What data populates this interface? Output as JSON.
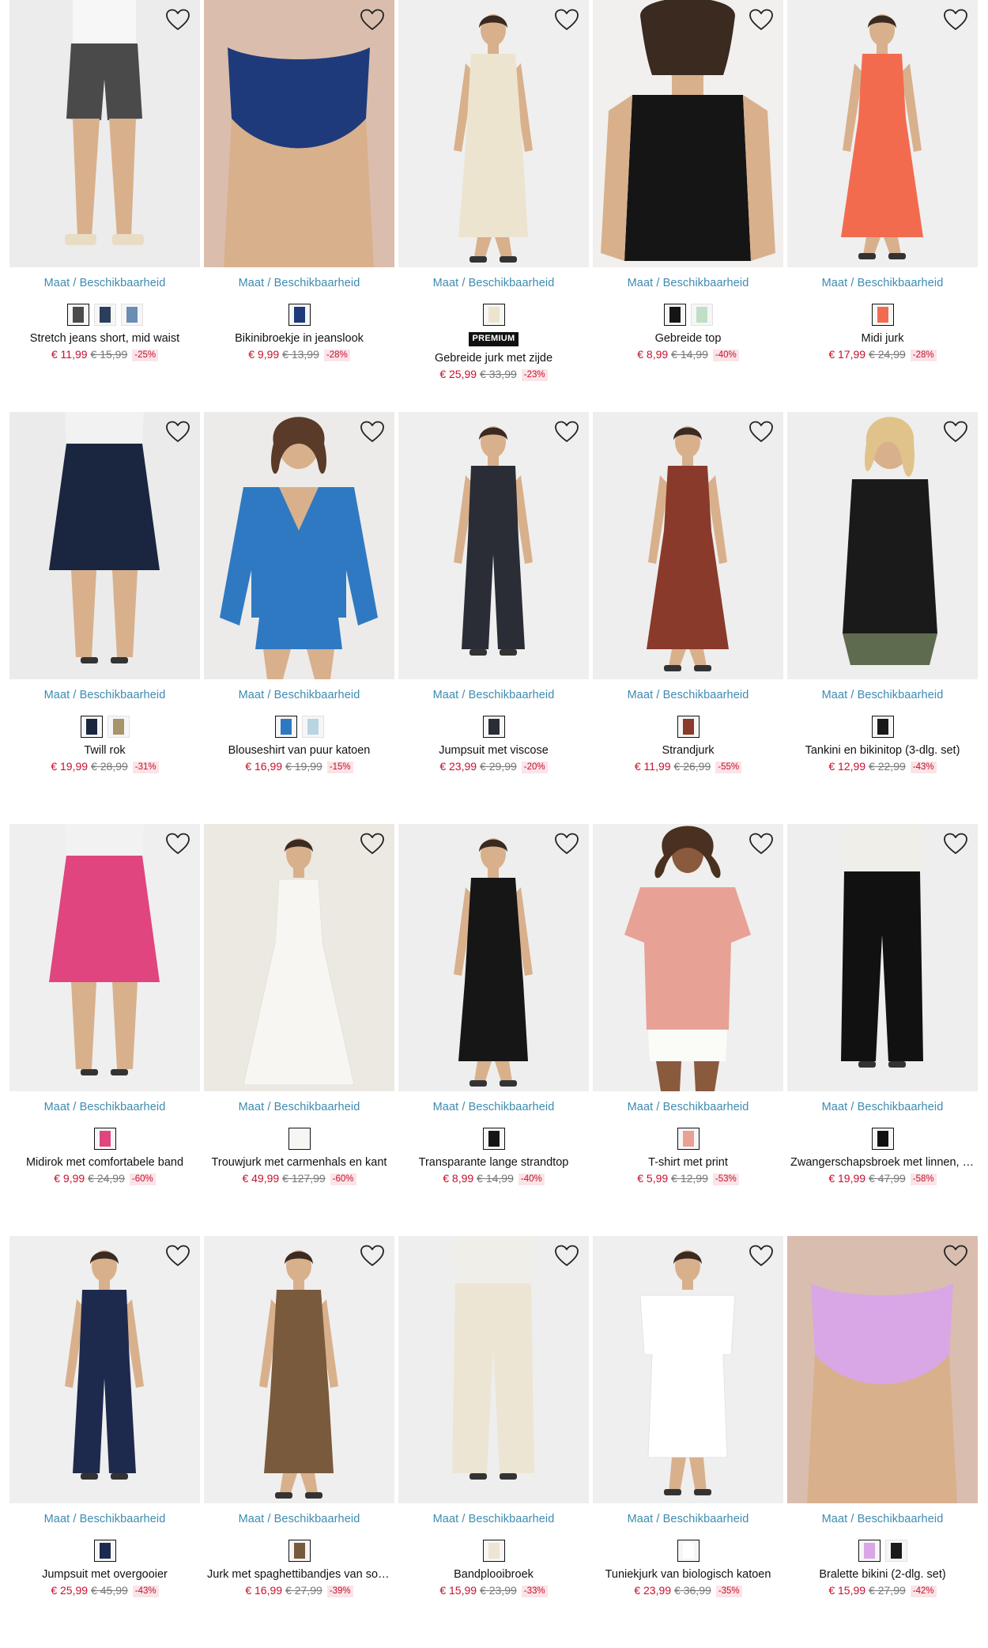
{
  "availability_label": "Maat / Beschikbaarheid",
  "premium_label": "PREMIUM",
  "products": [
    {
      "name": "Stretch jeans short, mid waist",
      "price": "€ 11,99",
      "old_price": "€ 15,99",
      "discount": "-25%",
      "bg": "#ececec",
      "figure": "shorts",
      "colors": [
        "#4a4a4a",
        "#2b3e5c",
        "#6b8cb3"
      ]
    },
    {
      "name": "Bikinibroekje in jeanslook",
      "price": "€ 9,99",
      "old_price": "€ 13,99",
      "discount": "-28%",
      "bg": "#f0eee9",
      "figure": "bikini",
      "colors": [
        "#1f3a7a"
      ]
    },
    {
      "name": "Gebreide jurk met zijde",
      "price": "€ 25,99",
      "old_price": "€ 33,99",
      "discount": "-23%",
      "bg": "#efefef",
      "figure": "dress",
      "premium": true,
      "colors": [
        "#ece4cf"
      ]
    },
    {
      "name": "Gebreide top",
      "price": "€ 8,99",
      "old_price": "€ 14,99",
      "discount": "-40%",
      "bg": "#f1f0ee",
      "figure": "top",
      "colors": [
        "#151515",
        "#bfe0c6"
      ]
    },
    {
      "name": "Midi jurk",
      "price": "€ 17,99",
      "old_price": "€ 24,99",
      "discount": "-28%",
      "bg": "#efefef",
      "figure": "longdress",
      "colors": [
        "#f26b4f"
      ]
    },
    {
      "name": "Twill rok",
      "price": "€ 19,99",
      "old_price": "€ 28,99",
      "discount": "-31%",
      "bg": "#ebebeb",
      "figure": "skirt",
      "colors": [
        "#1a2540",
        "#a8946a"
      ]
    },
    {
      "name": "Blouseshirt van puur katoen",
      "price": "€ 16,99",
      "old_price": "€ 19,99",
      "discount": "-15%",
      "bg": "#ecebe9",
      "figure": "sweater",
      "colors": [
        "#2f79c2",
        "#b9d4e2"
      ]
    },
    {
      "name": "Jumpsuit met viscose",
      "price": "€ 23,99",
      "old_price": "€ 29,99",
      "discount": "-20%",
      "bg": "#efefef",
      "figure": "jumpsuit",
      "colors": [
        "#2a2d36"
      ]
    },
    {
      "name": "Strandjurk",
      "price": "€ 11,99",
      "old_price": "€ 26,99",
      "discount": "-55%",
      "bg": "#eeeeee",
      "figure": "longdress",
      "colors": [
        "#8a3a2a"
      ]
    },
    {
      "name": "Tankini en bikinitop (3-dlg. set)",
      "price": "€ 12,99",
      "old_price": "€ 22,99",
      "discount": "-43%",
      "bg": "#eeeeee",
      "figure": "tankini",
      "colors": [
        "#1a1a1a"
      ]
    },
    {
      "name": "Midirok met comfortabele band",
      "price": "€ 9,99",
      "old_price": "€ 24,99",
      "discount": "-60%",
      "bg": "#efefef",
      "figure": "skirt",
      "colors": [
        "#e0457f"
      ]
    },
    {
      "name": "Trouwjurk met carmenhals en kant",
      "price": "€ 49,99",
      "old_price": "€ 127,99",
      "discount": "-60%",
      "bg": "#ece8e2",
      "figure": "gown",
      "colors": [
        "#f7f6f2"
      ]
    },
    {
      "name": "Transparante lange strandtop",
      "price": "€ 8,99",
      "old_price": "€ 14,99",
      "discount": "-40%",
      "bg": "#eeeeee",
      "figure": "dress",
      "colors": [
        "#161616"
      ]
    },
    {
      "name": "T-shirt met print",
      "price": "€ 5,99",
      "old_price": "€ 12,99",
      "discount": "-53%",
      "bg": "#efefef",
      "figure": "tshirt",
      "colors": [
        "#e8a195"
      ]
    },
    {
      "name": "Zwangerschapsbroek met linnen, st…",
      "price": "€ 19,99",
      "old_price": "€ 47,99",
      "discount": "-58%",
      "bg": "#eeeeee",
      "figure": "pants",
      "colors": [
        "#111111"
      ]
    },
    {
      "name": "Jumpsuit met overgooier",
      "price": "€ 25,99",
      "old_price": "€ 45,99",
      "discount": "-43%",
      "bg": "#efefef",
      "figure": "jumpsuit",
      "colors": [
        "#1e2a4d"
      ]
    },
    {
      "name": "Jurk met spaghettibandjes van soe…",
      "price": "€ 16,99",
      "old_price": "€ 27,99",
      "discount": "-39%",
      "bg": "#efefef",
      "figure": "dress",
      "colors": [
        "#7a5a3c"
      ]
    },
    {
      "name": "Bandplooibroek",
      "price": "€ 15,99",
      "old_price": "€ 23,99",
      "discount": "-33%",
      "bg": "#eeeeee",
      "figure": "pants",
      "colors": [
        "#ece5d3"
      ]
    },
    {
      "name": "Tuniekjurk van biologisch katoen",
      "price": "€ 23,99",
      "old_price": "€ 36,99",
      "discount": "-35%",
      "bg": "#efefef",
      "figure": "tunic",
      "colors": [
        "#ffffff"
      ]
    },
    {
      "name": "Bralette bikini (2-dlg. set)",
      "price": "€ 15,99",
      "old_price": "€ 27,99",
      "discount": "-42%",
      "bg": "#eeeeee",
      "figure": "bikini",
      "colors": [
        "#d9a6e6",
        "#1a1a1a"
      ]
    }
  ]
}
